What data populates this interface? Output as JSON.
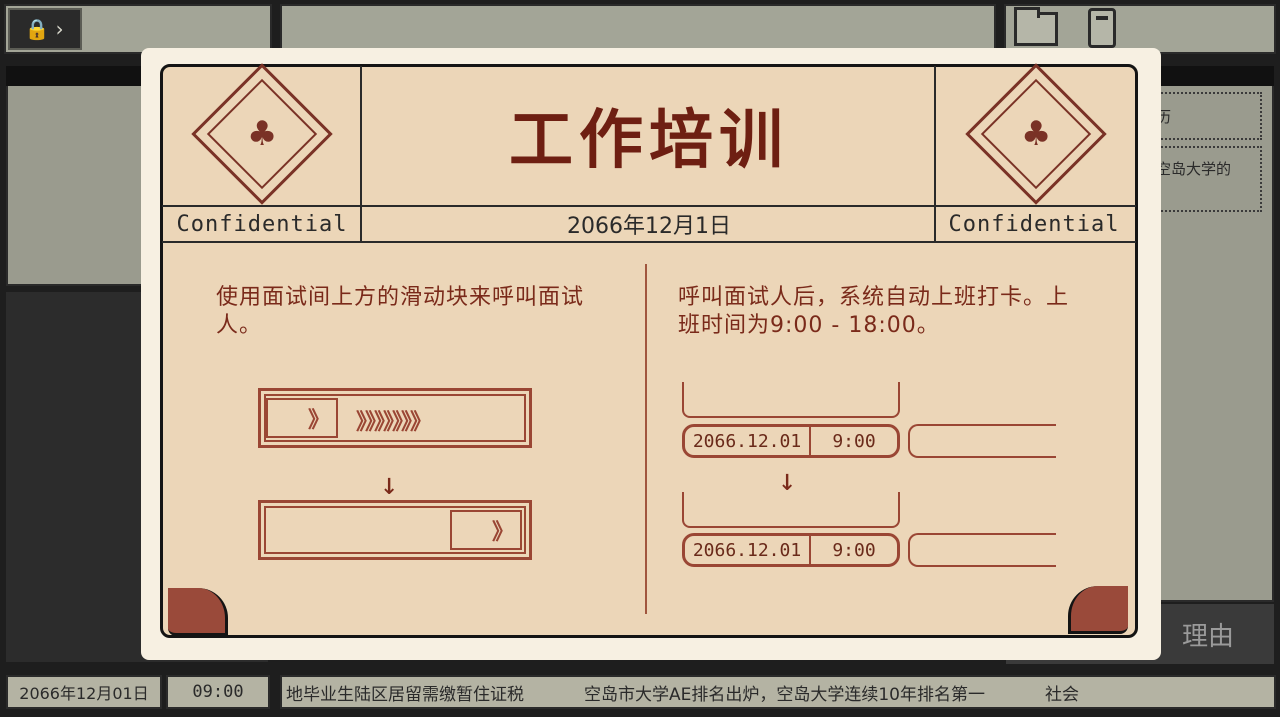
{
  "desk": {
    "resume_text_1": "历",
    "resume_text_2": "空岛大学的",
    "reason_button": "理由",
    "footer_date": "2066年12月01日",
    "footer_time": "09:00",
    "ticker_1": "地毕业生陆区居留需缴暂住证税",
    "ticker_2": "空岛市大学AE排名出炉，空岛大学连续10年排名第一",
    "ticker_3": "社会"
  },
  "document": {
    "title": "工作培训",
    "confidential_left": "Confidential",
    "confidential_right": "Confidential",
    "date": "2066年12月1日",
    "left_instruction": "使用面试间上方的滑动块来呼叫面试人。",
    "right_instruction": "呼叫面试人后，系统自动上班打卡。上班时间为9:00 - 18:00。",
    "slider_chevrons": "》》》》》》》",
    "slider_handle": "》",
    "arrow": "↓",
    "records": [
      {
        "date": "2066.12.01",
        "time": "9:00"
      },
      {
        "date": "2066.12.01",
        "time": "9:00"
      }
    ]
  },
  "icons": {
    "lock": "lock-icon",
    "folder": "folder-icon",
    "phone": "phone-icon",
    "emblem": "emblem-icon"
  },
  "colors": {
    "paper": "#ecd6b8",
    "title_red": "#6e1f12",
    "accent_brown": "#9a4634"
  }
}
